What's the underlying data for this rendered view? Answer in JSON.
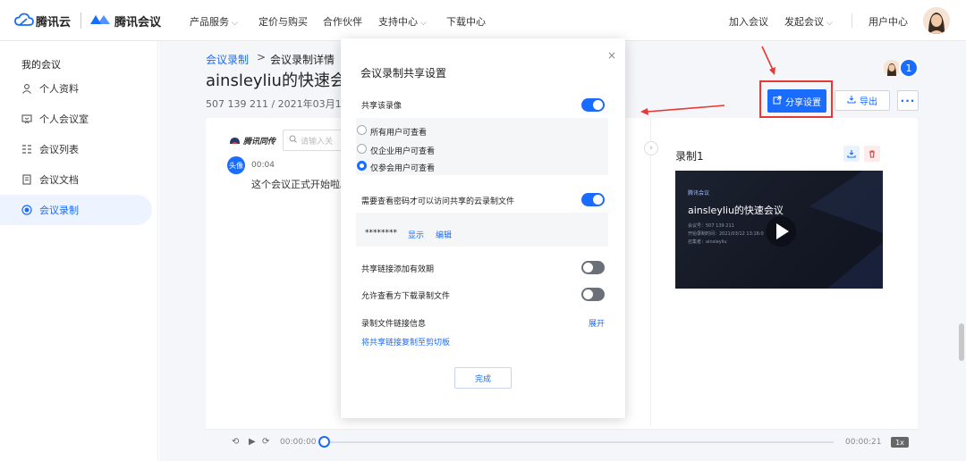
{
  "brand": {
    "cloud": "腾讯云",
    "meeting": "腾讯会议"
  },
  "nav": {
    "items": [
      "产品服务",
      "定价与购买",
      "合作伙伴",
      "支持中心",
      "下载中心"
    ],
    "right": [
      "加入会议",
      "发起会议",
      "用户中心"
    ]
  },
  "sidebar": {
    "heading": "我的会议",
    "items": [
      {
        "label": "个人资料",
        "icon": "person-icon"
      },
      {
        "label": "个人会议室",
        "icon": "room-icon"
      },
      {
        "label": "会议列表",
        "icon": "list-icon"
      },
      {
        "label": "会议文档",
        "icon": "doc-icon"
      },
      {
        "label": "会议录制",
        "icon": "record-icon",
        "active": true
      }
    ]
  },
  "main": {
    "breadcrumb": {
      "parent": "会议录制",
      "sep": ">",
      "current": "会议录制详情"
    },
    "title": "ainsleyliu的快速会",
    "meta": "507 139 211  / 2021年03月12",
    "badge_count": "1",
    "share_button": "分享设置",
    "export_button": "导出",
    "more_button": "···"
  },
  "transcript": {
    "logo": "腾讯同传",
    "search_placeholder": "请输入关",
    "speaker": "头像",
    "time": "00:04",
    "text": "这个会议正式开始啦。"
  },
  "recording": {
    "title": "录制1",
    "thumb_logo": "腾讯会议",
    "thumb_title": "ainsleyliu的快速会议",
    "thumb_meta": [
      "会议号：507 139 211",
      "开始录制时间：2021/03/12 13:16:0",
      "召集者：ainsleyliu"
    ]
  },
  "player": {
    "current": "00:00:00",
    "total": "00:00:21",
    "speed": "1x"
  },
  "modal": {
    "title": "会议录制共享设置",
    "close": "×",
    "share_label": "共享该录像",
    "options": [
      "所有用户可查看",
      "仅企业用户可查看",
      "仅参会用户可查看"
    ],
    "selected_option": 2,
    "password_label": "需要查看密码才可以访问共享的云录制文件",
    "password_mask": "********",
    "show_link": "显示",
    "edit_link": "编辑",
    "expiry_label": "共享链接添加有效期",
    "download_label": "允许查看方下载录制文件",
    "info_label": "录制文件链接信息",
    "expand_link": "展开",
    "copy_link": "将共享链接复制至剪切板",
    "done_button": "完成"
  },
  "colors": {
    "accent": "#1a6cff",
    "highlight": "#e53935"
  }
}
